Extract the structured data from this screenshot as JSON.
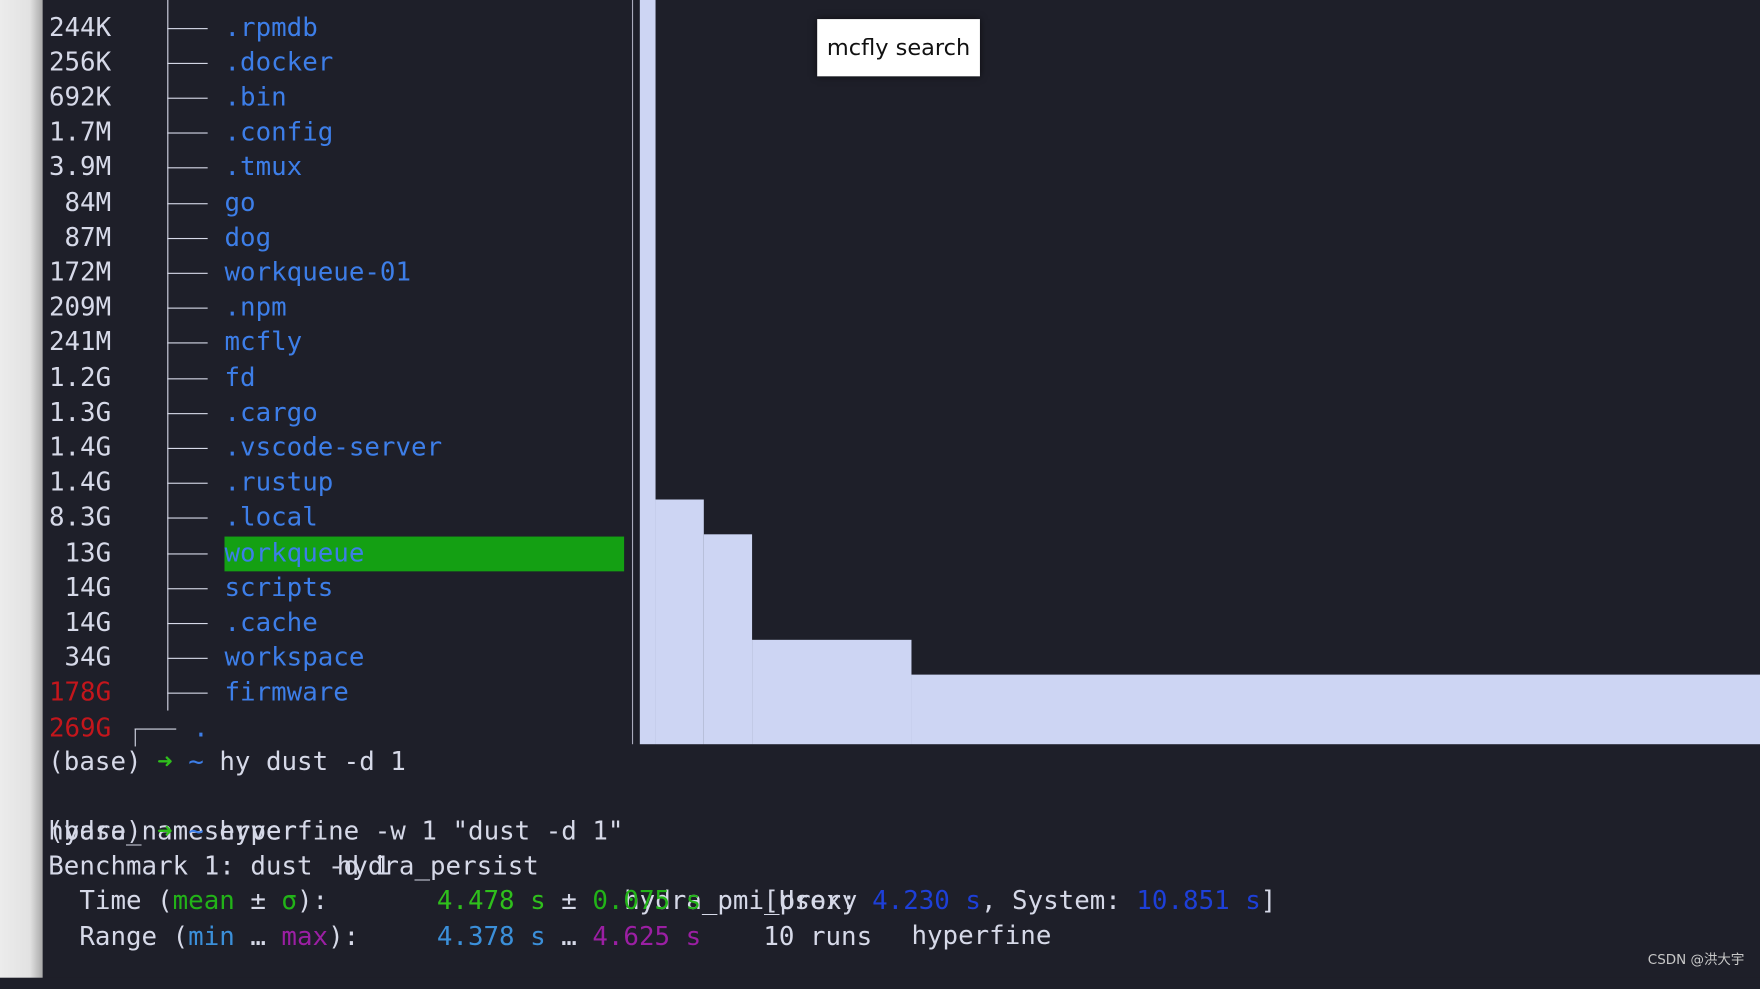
{
  "tree": [
    {
      "size": "244K",
      "name": ".rpmdb"
    },
    {
      "size": "256K",
      "name": ".docker"
    },
    {
      "size": "692K",
      "name": ".bin"
    },
    {
      "size": "1.7M",
      "name": ".config"
    },
    {
      "size": "3.9M",
      "name": ".tmux"
    },
    {
      "size": "84M",
      "name": "go"
    },
    {
      "size": "87M",
      "name": "dog"
    },
    {
      "size": "172M",
      "name": "workqueue-01"
    },
    {
      "size": "209M",
      "name": ".npm"
    },
    {
      "size": "241M",
      "name": "mcfly"
    },
    {
      "size": "1.2G",
      "name": "fd"
    },
    {
      "size": "1.3G",
      "name": ".cargo"
    },
    {
      "size": "1.4G",
      "name": ".vscode-server"
    },
    {
      "size": "1.4G",
      "name": ".rustup"
    },
    {
      "size": "8.3G",
      "name": ".local"
    },
    {
      "size": "13G",
      "name": "workqueue",
      "highlighted": true
    },
    {
      "size": "14G",
      "name": "scripts"
    },
    {
      "size": "14G",
      "name": ".cache"
    },
    {
      "size": "34G",
      "name": "workspace"
    },
    {
      "size": "178G",
      "name": "firmware",
      "size_color": "#c4161c"
    }
  ],
  "root": {
    "size": "269G",
    "name": ".",
    "size_color": "#c4161c"
  },
  "tooltip": "mcfly search",
  "terminal": {
    "prompt_env": "(base)",
    "arrow": "➜",
    "tilde": "~",
    "cmd1": "hy dust -d 1",
    "completions": [
      "hydra_nameserver",
      "hydra_persist",
      "hydra_pmi_proxy",
      "hyperfine"
    ],
    "cmd2": "hyperfine -w 1 \"dust -d 1\"",
    "benchmark": "Benchmark 1: dust -d 1",
    "time": {
      "label": "  Time (",
      "mean": "mean",
      "pm": " ± ",
      "sigma": "σ",
      "close": "):       ",
      "mean_val": "4.478 s",
      "pm2": " ± ",
      "sigma_val": "0.075 s",
      "user_lbl": "    [User: ",
      "user_val": "4.230 s",
      "sys_lbl": ", System: ",
      "sys_val": "10.851 s",
      "end": "]"
    },
    "range": {
      "label": "  Range (",
      "min": "min",
      "ell": " … ",
      "max": "max",
      "close": "):     ",
      "min_val": "4.378 s",
      "ell2": " … ",
      "max_val": "4.625 s",
      "runs": "    10 runs"
    }
  },
  "watermark": "CSDN @洪大宇",
  "colors": {
    "background": "#1e1f29",
    "dir_blue": "#3d7ee8",
    "size_red": "#c4161c",
    "highlight_green": "#14a013",
    "bar": "#cdd5f3"
  }
}
